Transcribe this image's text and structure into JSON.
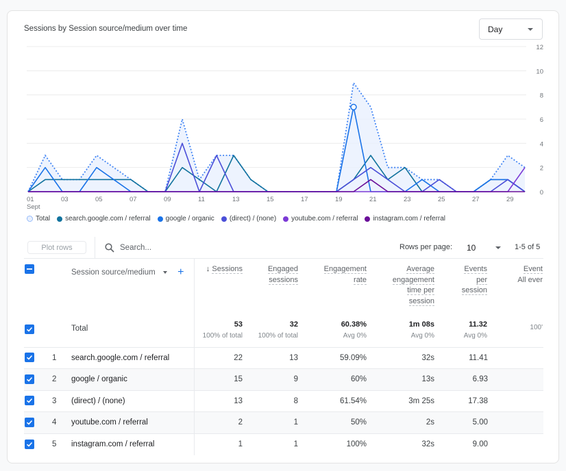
{
  "card": {
    "title": "Sessions by Session source/medium over time",
    "granularity": "Day"
  },
  "chart_data": {
    "type": "line",
    "title": "Sessions by Session source/medium over time",
    "x": [
      1,
      2,
      3,
      4,
      5,
      6,
      7,
      8,
      9,
      10,
      11,
      12,
      13,
      14,
      15,
      16,
      17,
      18,
      19,
      20,
      21,
      22,
      23,
      24,
      25,
      26,
      27,
      28,
      29,
      30
    ],
    "x_tick_labels": [
      "01",
      "03",
      "05",
      "07",
      "09",
      "11",
      "13",
      "15",
      "17",
      "19",
      "21",
      "23",
      "25",
      "27",
      "29"
    ],
    "x_tick_days": [
      1,
      3,
      5,
      7,
      9,
      11,
      13,
      15,
      17,
      19,
      21,
      23,
      25,
      27,
      29
    ],
    "x_sublabel": "Sept",
    "y_ticks": [
      0,
      2,
      4,
      6,
      8,
      10,
      12
    ],
    "ylim": [
      0,
      12
    ],
    "y_axis_side": "right",
    "grid": true,
    "legend_position": "bottom-left",
    "highlight_point": {
      "series": "google / organic",
      "day": 20
    },
    "series": [
      {
        "name": "Total",
        "color": "#4285f4",
        "style": "dotted-area",
        "values": [
          0,
          3,
          1,
          1,
          3,
          2,
          1,
          0,
          0,
          6,
          1,
          3,
          3,
          1,
          0,
          0,
          0,
          0,
          0,
          9,
          7,
          2,
          2,
          1,
          1,
          0,
          0,
          1,
          3,
          2
        ]
      },
      {
        "name": "search.google.com / referral",
        "color": "#12739e",
        "style": "line",
        "values": [
          0,
          1,
          1,
          1,
          1,
          1,
          1,
          0,
          0,
          2,
          1,
          0,
          3,
          1,
          0,
          0,
          0,
          0,
          0,
          1,
          3,
          1,
          2,
          0,
          0,
          0,
          0,
          1,
          1,
          0
        ]
      },
      {
        "name": "google / organic",
        "color": "#1a73e8",
        "style": "line",
        "values": [
          0,
          2,
          0,
          0,
          2,
          1,
          0,
          0,
          0,
          0,
          0,
          0,
          0,
          0,
          0,
          0,
          0,
          0,
          0,
          7,
          0,
          0,
          0,
          1,
          0,
          0,
          0,
          1,
          1,
          0
        ]
      },
      {
        "name": "(direct) / (none)",
        "color": "#4b4fd8",
        "style": "line",
        "values": [
          0,
          0,
          0,
          0,
          0,
          0,
          0,
          0,
          0,
          4,
          0,
          3,
          0,
          0,
          0,
          0,
          0,
          0,
          0,
          1,
          2,
          1,
          0,
          0,
          1,
          0,
          0,
          0,
          1,
          0
        ]
      },
      {
        "name": "youtube.com / referral",
        "color": "#7c3ad6",
        "style": "line",
        "values": [
          0,
          0,
          0,
          0,
          0,
          0,
          0,
          0,
          0,
          0,
          0,
          0,
          0,
          0,
          0,
          0,
          0,
          0,
          0,
          0,
          0,
          0,
          0,
          0,
          0,
          0,
          0,
          0,
          0,
          2
        ]
      },
      {
        "name": "instagram.com / referral",
        "color": "#6a0f99",
        "style": "line",
        "values": [
          0,
          0,
          0,
          0,
          0,
          0,
          0,
          0,
          0,
          0,
          0,
          0,
          0,
          0,
          0,
          0,
          0,
          0,
          0,
          0,
          1,
          0,
          0,
          0,
          0,
          0,
          0,
          0,
          0,
          0
        ]
      }
    ]
  },
  "legend": [
    {
      "label": "Total",
      "color": "#4285f4",
      "type": "total"
    },
    {
      "label": "search.google.com / referral",
      "color": "#12739e"
    },
    {
      "label": "google / organic",
      "color": "#1a73e8"
    },
    {
      "label": "(direct) / (none)",
      "color": "#4b4fd8"
    },
    {
      "label": "youtube.com / referral",
      "color": "#7c3ad6"
    },
    {
      "label": "instagram.com / referral",
      "color": "#6a0f99"
    }
  ],
  "toolbar": {
    "plot_rows_label": "Plot rows",
    "search_placeholder": "Search...",
    "rows_per_page_label": "Rows per page:",
    "rows_per_page_value": "10",
    "pagination": "1-5 of 5"
  },
  "table": {
    "dimension_header": "Session source/medium",
    "add_dimension": "+",
    "sort_arrow": "↓",
    "columns": [
      {
        "label_lines": [
          "Sessions"
        ]
      },
      {
        "label_lines": [
          "Engaged",
          "sessions"
        ]
      },
      {
        "label_lines": [
          "Engagement",
          "rate"
        ]
      },
      {
        "label_lines": [
          "Average",
          "engagement",
          "time per",
          "session"
        ]
      },
      {
        "label_lines": [
          "Events",
          "per",
          "session"
        ]
      },
      {
        "label_lines": [
          "Event",
          "All ever"
        ]
      }
    ],
    "total": {
      "label": "Total",
      "values": [
        "53",
        "32",
        "60.38%",
        "1m 08s",
        "11.32",
        ""
      ],
      "subs": [
        "100% of total",
        "100% of total",
        "Avg 0%",
        "Avg 0%",
        "Avg 0%",
        "100'"
      ]
    },
    "rows": [
      {
        "index": "1",
        "name": "search.google.com / referral",
        "values": [
          "22",
          "13",
          "59.09%",
          "32s",
          "11.41",
          ""
        ]
      },
      {
        "index": "2",
        "name": "google / organic",
        "values": [
          "15",
          "9",
          "60%",
          "13s",
          "6.93",
          ""
        ]
      },
      {
        "index": "3",
        "name": "(direct) / (none)",
        "values": [
          "13",
          "8",
          "61.54%",
          "3m 25s",
          "17.38",
          ""
        ]
      },
      {
        "index": "4",
        "name": "youtube.com / referral",
        "values": [
          "2",
          "1",
          "50%",
          "2s",
          "5.00",
          ""
        ]
      },
      {
        "index": "5",
        "name": "instagram.com / referral",
        "values": [
          "1",
          "1",
          "100%",
          "32s",
          "9.00",
          ""
        ]
      }
    ]
  }
}
